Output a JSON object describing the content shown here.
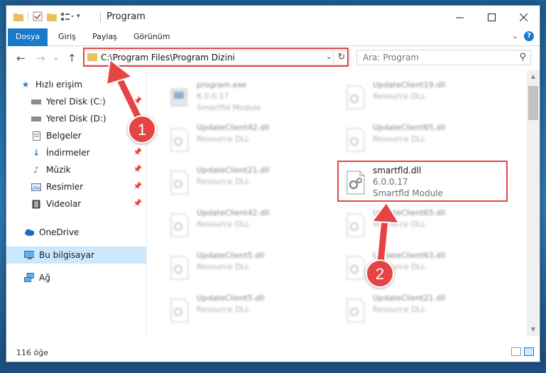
{
  "window": {
    "title": "Program"
  },
  "ribbon": {
    "tabs": [
      "Dosya",
      "Giriş",
      "Paylaş",
      "Görünüm"
    ],
    "help": "?"
  },
  "nav": {
    "address": "C:\\Program Files\\Program Dizini",
    "search_placeholder": "Ara: Program"
  },
  "sidebar": {
    "items": [
      {
        "label": "Hızlı erişim",
        "icon": "star-icon",
        "pinned": false
      },
      {
        "label": "Yerel Disk (C:)",
        "icon": "drive-icon",
        "pinned": true
      },
      {
        "label": "Yerel Disk (D:)",
        "icon": "drive-icon",
        "pinned": false
      },
      {
        "label": "Belgeler",
        "icon": "document-icon",
        "pinned": true
      },
      {
        "label": "İndirmeler",
        "icon": "download-icon",
        "pinned": true
      },
      {
        "label": "Müzik",
        "icon": "music-icon",
        "pinned": true
      },
      {
        "label": "Resimler",
        "icon": "picture-icon",
        "pinned": true
      },
      {
        "label": "Videolar",
        "icon": "video-icon",
        "pinned": true
      },
      {
        "label": "OneDrive",
        "icon": "cloud-icon",
        "pinned": false
      },
      {
        "label": "Bu bilgisayar",
        "icon": "computer-icon",
        "pinned": false,
        "selected": true
      },
      {
        "label": "Ağ",
        "icon": "network-icon",
        "pinned": false
      }
    ]
  },
  "files": [
    {
      "name": "program.exe",
      "version": "6.0.0.17",
      "desc": "Smartfld Module",
      "blur": true
    },
    {
      "name": "UpdateClient19.dll",
      "version": "Resource DLL",
      "desc": "",
      "blur": true
    },
    {
      "name": "UpdateClient42.dll",
      "version": "Resource DLL",
      "desc": "",
      "blur": true
    },
    {
      "name": "UpdateClient65.dll",
      "version": "Resource DLL",
      "desc": "",
      "blur": true
    },
    {
      "name": "UpdateClient21.dll",
      "version": "Resource DLL",
      "desc": "",
      "blur": true
    },
    {
      "name": "smartfld.dll",
      "version": "6.0.0.17",
      "desc": "Smartfld Module",
      "blur": false
    },
    {
      "name": "UpdateClient42.dll",
      "version": "Resource DLL",
      "desc": "",
      "blur": true
    },
    {
      "name": "UpdateClient65.dll",
      "version": "Resource DLL",
      "desc": "",
      "blur": true
    },
    {
      "name": "UpdateClient5.dll",
      "version": "Resource DLL",
      "desc": "",
      "blur": true
    },
    {
      "name": "UpdateClient63.dll",
      "version": "Resource DLL",
      "desc": "",
      "blur": true
    },
    {
      "name": "UpdateClient5.dll",
      "version": "Resource DLL",
      "desc": "",
      "blur": true
    },
    {
      "name": "UpdateClient21.dll",
      "version": "Resource DLL",
      "desc": "",
      "blur": true
    }
  ],
  "status": {
    "count": "116 öğe"
  },
  "annotations": {
    "step1": "1",
    "step2": "2",
    "color": "#e44444"
  }
}
